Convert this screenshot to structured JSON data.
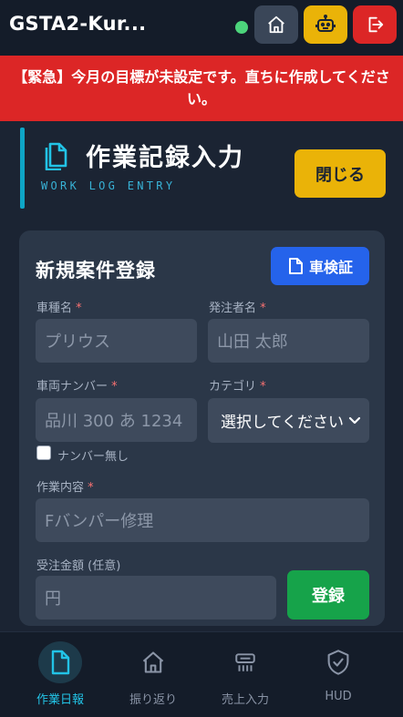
{
  "header": {
    "app_title": "GSTA2-Kur...",
    "icons": [
      "home-icon",
      "robot-icon",
      "logout-icon"
    ]
  },
  "alert": {
    "text": "【緊急】今月の目標が未設定です。直ちに作成してください。"
  },
  "page": {
    "title": "作業記録入力",
    "subtitle": "WORK LOG ENTRY",
    "close_label": "閉じる"
  },
  "form": {
    "title": "新規案件登録",
    "inspection_label": "車検証",
    "required_mark": "*",
    "car_model": {
      "label": "車種名",
      "placeholder": "プリウス"
    },
    "client": {
      "label": "発注者名",
      "placeholder": "山田 太郎"
    },
    "plate": {
      "label": "車両ナンバー",
      "placeholder": "品川 300 あ 1234"
    },
    "category": {
      "label": "カテゴリ",
      "value": "選択してください"
    },
    "no_plate_label": "ナンバー無し",
    "work": {
      "label": "作業内容",
      "placeholder": "Fバンパー修理"
    },
    "amount": {
      "label": "受注金額 (任意)",
      "placeholder": "円"
    },
    "submit_label": "登録"
  },
  "nav": {
    "items": [
      {
        "label": "作業日報",
        "icon": "document-icon",
        "active": true
      },
      {
        "label": "振り返り",
        "icon": "home-icon",
        "active": false
      },
      {
        "label": "売上入力",
        "icon": "register-icon",
        "active": false
      },
      {
        "label": "HUD",
        "icon": "shield-check-icon",
        "active": false
      }
    ]
  },
  "colors": {
    "background": "#1b2433",
    "alert": "#dc2626",
    "accent_cyan": "#22c3e6",
    "yellow": "#eab308",
    "blue": "#2563eb",
    "green": "#16a34a"
  }
}
